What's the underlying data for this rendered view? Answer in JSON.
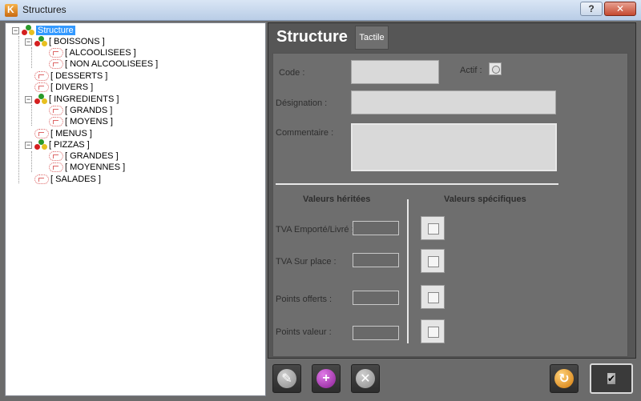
{
  "window": {
    "title": "Structures",
    "help_label": "?",
    "close_label": "✕"
  },
  "tree": {
    "root": "Structure",
    "items": [
      {
        "label": "[ BOISSONS ]",
        "level": 1,
        "type": "group",
        "expander": "⊟"
      },
      {
        "label": "[ ALCOOLISEES ]",
        "level": 2,
        "type": "leaf"
      },
      {
        "label": "[ NON ALCOOLISEES ]",
        "level": 2,
        "type": "leaf"
      },
      {
        "label": "[ DESSERTS ]",
        "level": 1,
        "type": "leaf"
      },
      {
        "label": "[ DIVERS ]",
        "level": 1,
        "type": "leaf"
      },
      {
        "label": "[ INGREDIENTS ]",
        "level": 1,
        "type": "group",
        "expander": "⊟"
      },
      {
        "label": "[ GRANDS ]",
        "level": 2,
        "type": "leaf"
      },
      {
        "label": "[ MOYENS ]",
        "level": 2,
        "type": "leaf"
      },
      {
        "label": "[ MENUS ]",
        "level": 1,
        "type": "leaf"
      },
      {
        "label": "[ PIZZAS ]",
        "level": 1,
        "type": "group",
        "expander": "⊟"
      },
      {
        "label": "[ GRANDES ]",
        "level": 2,
        "type": "leaf"
      },
      {
        "label": "[ MOYENNES ]",
        "level": 2,
        "type": "leaf"
      },
      {
        "label": "[ SALADES ]",
        "level": 1,
        "type": "leaf"
      }
    ]
  },
  "tabs": {
    "main": "Structure",
    "tactile": "Tactile"
  },
  "form": {
    "code_label": "Code :",
    "actif_label": "Actif :",
    "designation_label": "Désignation :",
    "commentaire_label": "Commentaire :",
    "code_value": "",
    "designation_value": "",
    "commentaire_value": ""
  },
  "values": {
    "herited_header": "Valeurs héritées",
    "specific_header": "Valeurs spécifiques",
    "rows": [
      {
        "label": "TVA Emporté/Livré :",
        "value": ""
      },
      {
        "label": "TVA Sur place :",
        "value": ""
      },
      {
        "label": "Points offerts :",
        "value": ""
      },
      {
        "label": "Points valeur :",
        "value": ""
      }
    ]
  },
  "toolbar": {
    "edit_icon": "✎",
    "add_icon": "+",
    "delete_icon": "✕",
    "refresh_icon": "↻",
    "ok_icon": "✔"
  }
}
